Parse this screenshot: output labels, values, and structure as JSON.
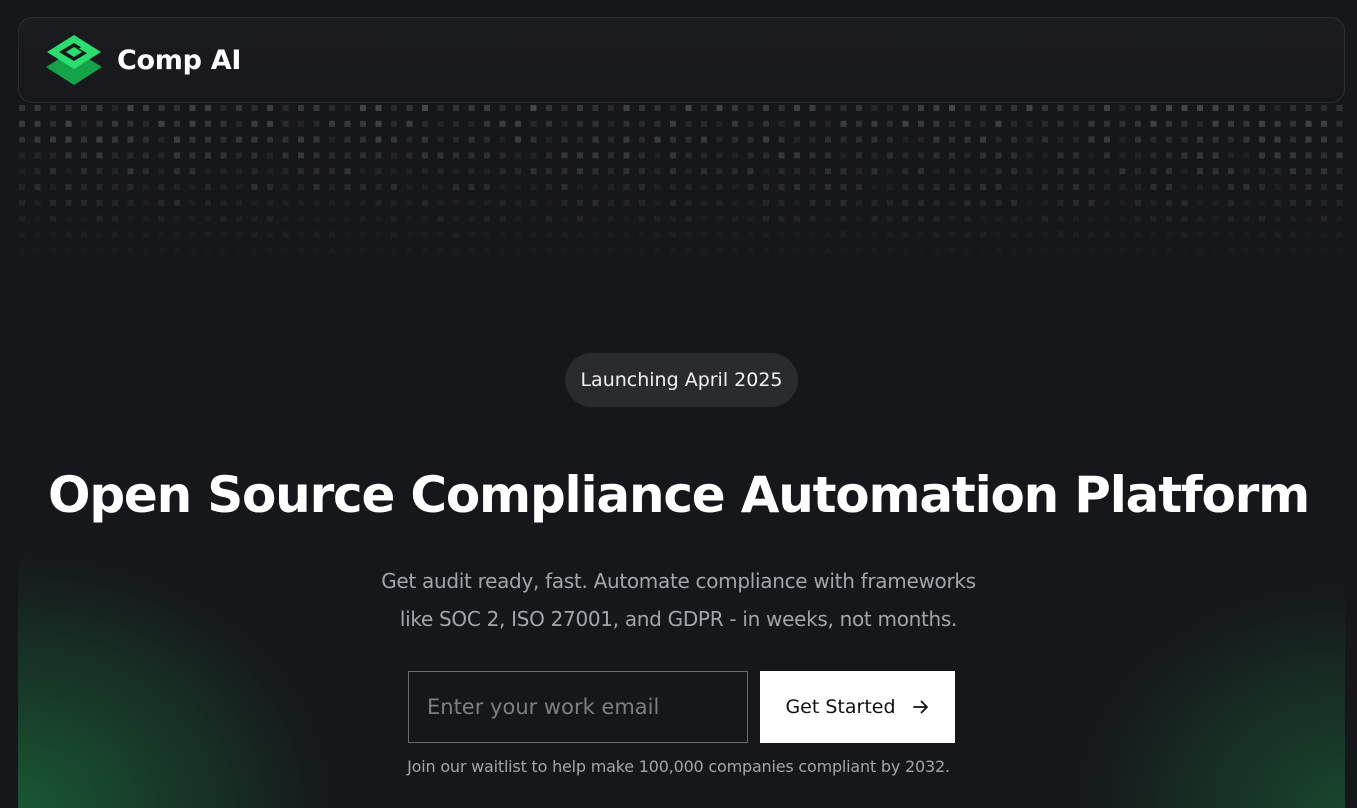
{
  "brand": {
    "name": "Comp AI",
    "logo_icon": "comp-ai-logo-icon",
    "accent_color": "#22c55e"
  },
  "hero": {
    "badge": "Launching April 2025",
    "headline": "Open Source Compliance Automation Platform",
    "subtitle_lines": [
      "Get audit ready, fast. Automate compliance with frameworks",
      "like SOC 2, ISO 27001, and GDPR - in weeks, not months."
    ],
    "email_placeholder": "Enter your work email",
    "email_value": "",
    "cta_label": "Get Started",
    "cta_icon": "arrow-right-icon",
    "footnote": "Join our waitlist to help make 100,000 companies compliant by 2032."
  },
  "colors": {
    "background": "#16171b",
    "badge_background": "#2a2b2f",
    "muted_text": "#a3a5ab",
    "glow": "#1a8c48"
  }
}
